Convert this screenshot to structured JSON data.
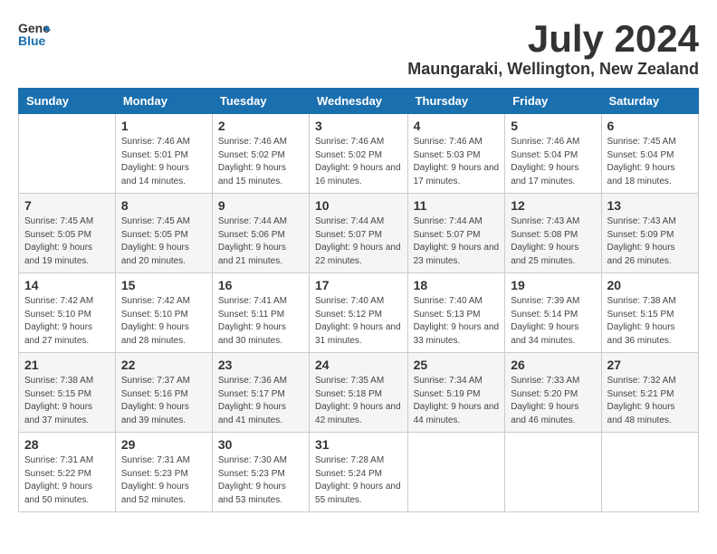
{
  "header": {
    "logo_general": "General",
    "logo_blue": "Blue",
    "month_title": "July 2024",
    "location": "Maungaraki, Wellington, New Zealand"
  },
  "weekdays": [
    "Sunday",
    "Monday",
    "Tuesday",
    "Wednesday",
    "Thursday",
    "Friday",
    "Saturday"
  ],
  "weeks": [
    [
      {
        "day": "",
        "sunrise": "",
        "sunset": "",
        "daylight": "",
        "empty": true
      },
      {
        "day": "1",
        "sunrise": "Sunrise: 7:46 AM",
        "sunset": "Sunset: 5:01 PM",
        "daylight": "Daylight: 9 hours and 14 minutes."
      },
      {
        "day": "2",
        "sunrise": "Sunrise: 7:46 AM",
        "sunset": "Sunset: 5:02 PM",
        "daylight": "Daylight: 9 hours and 15 minutes."
      },
      {
        "day": "3",
        "sunrise": "Sunrise: 7:46 AM",
        "sunset": "Sunset: 5:02 PM",
        "daylight": "Daylight: 9 hours and 16 minutes."
      },
      {
        "day": "4",
        "sunrise": "Sunrise: 7:46 AM",
        "sunset": "Sunset: 5:03 PM",
        "daylight": "Daylight: 9 hours and 17 minutes."
      },
      {
        "day": "5",
        "sunrise": "Sunrise: 7:46 AM",
        "sunset": "Sunset: 5:04 PM",
        "daylight": "Daylight: 9 hours and 17 minutes."
      },
      {
        "day": "6",
        "sunrise": "Sunrise: 7:45 AM",
        "sunset": "Sunset: 5:04 PM",
        "daylight": "Daylight: 9 hours and 18 minutes."
      }
    ],
    [
      {
        "day": "7",
        "sunrise": "Sunrise: 7:45 AM",
        "sunset": "Sunset: 5:05 PM",
        "daylight": "Daylight: 9 hours and 19 minutes."
      },
      {
        "day": "8",
        "sunrise": "Sunrise: 7:45 AM",
        "sunset": "Sunset: 5:05 PM",
        "daylight": "Daylight: 9 hours and 20 minutes."
      },
      {
        "day": "9",
        "sunrise": "Sunrise: 7:44 AM",
        "sunset": "Sunset: 5:06 PM",
        "daylight": "Daylight: 9 hours and 21 minutes."
      },
      {
        "day": "10",
        "sunrise": "Sunrise: 7:44 AM",
        "sunset": "Sunset: 5:07 PM",
        "daylight": "Daylight: 9 hours and 22 minutes."
      },
      {
        "day": "11",
        "sunrise": "Sunrise: 7:44 AM",
        "sunset": "Sunset: 5:07 PM",
        "daylight": "Daylight: 9 hours and 23 minutes."
      },
      {
        "day": "12",
        "sunrise": "Sunrise: 7:43 AM",
        "sunset": "Sunset: 5:08 PM",
        "daylight": "Daylight: 9 hours and 25 minutes."
      },
      {
        "day": "13",
        "sunrise": "Sunrise: 7:43 AM",
        "sunset": "Sunset: 5:09 PM",
        "daylight": "Daylight: 9 hours and 26 minutes."
      }
    ],
    [
      {
        "day": "14",
        "sunrise": "Sunrise: 7:42 AM",
        "sunset": "Sunset: 5:10 PM",
        "daylight": "Daylight: 9 hours and 27 minutes."
      },
      {
        "day": "15",
        "sunrise": "Sunrise: 7:42 AM",
        "sunset": "Sunset: 5:10 PM",
        "daylight": "Daylight: 9 hours and 28 minutes."
      },
      {
        "day": "16",
        "sunrise": "Sunrise: 7:41 AM",
        "sunset": "Sunset: 5:11 PM",
        "daylight": "Daylight: 9 hours and 30 minutes."
      },
      {
        "day": "17",
        "sunrise": "Sunrise: 7:40 AM",
        "sunset": "Sunset: 5:12 PM",
        "daylight": "Daylight: 9 hours and 31 minutes."
      },
      {
        "day": "18",
        "sunrise": "Sunrise: 7:40 AM",
        "sunset": "Sunset: 5:13 PM",
        "daylight": "Daylight: 9 hours and 33 minutes."
      },
      {
        "day": "19",
        "sunrise": "Sunrise: 7:39 AM",
        "sunset": "Sunset: 5:14 PM",
        "daylight": "Daylight: 9 hours and 34 minutes."
      },
      {
        "day": "20",
        "sunrise": "Sunrise: 7:38 AM",
        "sunset": "Sunset: 5:15 PM",
        "daylight": "Daylight: 9 hours and 36 minutes."
      }
    ],
    [
      {
        "day": "21",
        "sunrise": "Sunrise: 7:38 AM",
        "sunset": "Sunset: 5:15 PM",
        "daylight": "Daylight: 9 hours and 37 minutes."
      },
      {
        "day": "22",
        "sunrise": "Sunrise: 7:37 AM",
        "sunset": "Sunset: 5:16 PM",
        "daylight": "Daylight: 9 hours and 39 minutes."
      },
      {
        "day": "23",
        "sunrise": "Sunrise: 7:36 AM",
        "sunset": "Sunset: 5:17 PM",
        "daylight": "Daylight: 9 hours and 41 minutes."
      },
      {
        "day": "24",
        "sunrise": "Sunrise: 7:35 AM",
        "sunset": "Sunset: 5:18 PM",
        "daylight": "Daylight: 9 hours and 42 minutes."
      },
      {
        "day": "25",
        "sunrise": "Sunrise: 7:34 AM",
        "sunset": "Sunset: 5:19 PM",
        "daylight": "Daylight: 9 hours and 44 minutes."
      },
      {
        "day": "26",
        "sunrise": "Sunrise: 7:33 AM",
        "sunset": "Sunset: 5:20 PM",
        "daylight": "Daylight: 9 hours and 46 minutes."
      },
      {
        "day": "27",
        "sunrise": "Sunrise: 7:32 AM",
        "sunset": "Sunset: 5:21 PM",
        "daylight": "Daylight: 9 hours and 48 minutes."
      }
    ],
    [
      {
        "day": "28",
        "sunrise": "Sunrise: 7:31 AM",
        "sunset": "Sunset: 5:22 PM",
        "daylight": "Daylight: 9 hours and 50 minutes."
      },
      {
        "day": "29",
        "sunrise": "Sunrise: 7:31 AM",
        "sunset": "Sunset: 5:23 PM",
        "daylight": "Daylight: 9 hours and 52 minutes."
      },
      {
        "day": "30",
        "sunrise": "Sunrise: 7:30 AM",
        "sunset": "Sunset: 5:23 PM",
        "daylight": "Daylight: 9 hours and 53 minutes."
      },
      {
        "day": "31",
        "sunrise": "Sunrise: 7:28 AM",
        "sunset": "Sunset: 5:24 PM",
        "daylight": "Daylight: 9 hours and 55 minutes."
      },
      {
        "day": "",
        "sunrise": "",
        "sunset": "",
        "daylight": "",
        "empty": true
      },
      {
        "day": "",
        "sunrise": "",
        "sunset": "",
        "daylight": "",
        "empty": true
      },
      {
        "day": "",
        "sunrise": "",
        "sunset": "",
        "daylight": "",
        "empty": true
      }
    ]
  ]
}
